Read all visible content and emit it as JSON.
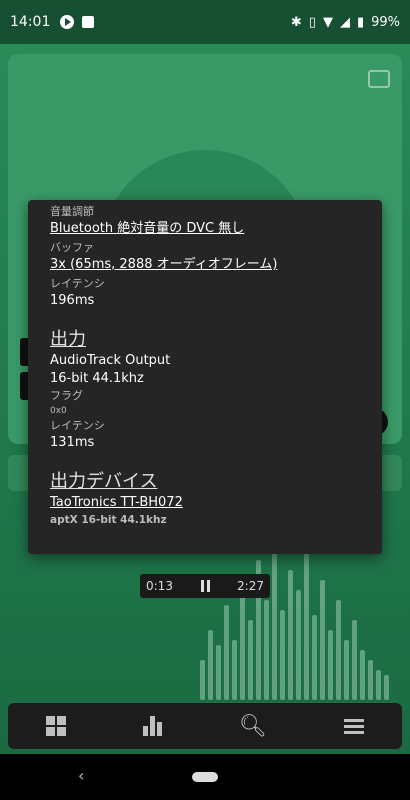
{
  "status_bar": {
    "time": "14:01",
    "battery": "99%",
    "icons": [
      "play-circle-icon",
      "stop-icon",
      "bluetooth-icon",
      "vibrate-icon",
      "wifi-icon",
      "signal-icon",
      "battery-icon"
    ]
  },
  "popup": {
    "volume_label": "音量調節",
    "volume_value": "Bluetooth 絶対音量の DVC 無し",
    "buffer_label": "バッファ",
    "buffer_value": "3x (65ms, 2888 オーディオフレーム)",
    "latency_label": "レイテンシ",
    "latency_value": "196ms",
    "output_heading": "出力",
    "output_name": "AudioTrack Output",
    "output_format": "16-bit 44.1khz",
    "flags_label": "フラグ",
    "flags_value": "0x0",
    "out_latency_label": "レイテンシ",
    "out_latency_value": "131ms",
    "device_heading": "出力デバイス",
    "device_name": "TaoTronics TT-BH072",
    "device_codec": "aptX 16-bit 44.1khz"
  },
  "player": {
    "elapsed": "0:13",
    "duration": "2:27"
  },
  "colors": {
    "accent": "#2a8a58",
    "popup_bg": "#252525",
    "nav_bg": "#1c1c1c"
  }
}
